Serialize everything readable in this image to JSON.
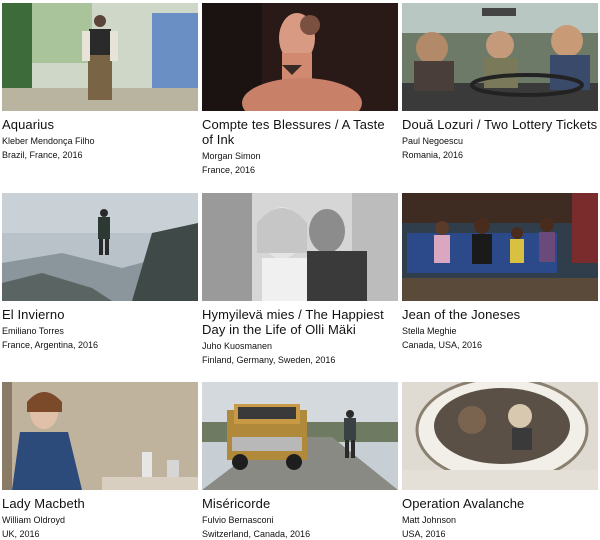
{
  "films": [
    {
      "title": "Aquarius",
      "director": "Kleber Mendonça Filho",
      "meta": "Brazil, France, 2016",
      "thumb": "woman-standing-outdoors-photo"
    },
    {
      "title": "Compte tes Blessures / A Taste of Ink",
      "director": "Morgan Simon",
      "meta": "France, 2016",
      "thumb": "shirtless-man-tattoo-photo"
    },
    {
      "title": "Două Lozuri / Two Lottery Tickets",
      "director": "Paul Negoescu",
      "meta": "Romania, 2016",
      "thumb": "three-men-in-car-photo"
    },
    {
      "title": "El Invierno",
      "director": "Emiliano Torres",
      "meta": "France, Argentina, 2016",
      "thumb": "man-on-misty-hill-photo"
    },
    {
      "title": "Hymyilevä mies / The Happiest Day in the Life of Olli Mäki",
      "director": "Juho Kuosmanen",
      "meta": "Finland, Germany, Sweden, 2016",
      "thumb": "black-white-couple-photo"
    },
    {
      "title": "Jean of the Joneses",
      "director": "Stella Meghie",
      "meta": "Canada, USA, 2016",
      "thumb": "family-on-couch-photo"
    },
    {
      "title": "Lady Macbeth",
      "director": "William Oldroyd",
      "meta": "UK, 2016",
      "thumb": "woman-in-blue-dress-photo"
    },
    {
      "title": "Miséricorde",
      "director": "Fulvio Bernasconi",
      "meta": "Switzerland, Canada, 2016",
      "thumb": "pickup-truck-road-photo"
    },
    {
      "title": "Operation Avalanche",
      "director": "Matt Johnson",
      "meta": "USA, 2016",
      "thumb": "astronaut-helmet-photo"
    }
  ]
}
